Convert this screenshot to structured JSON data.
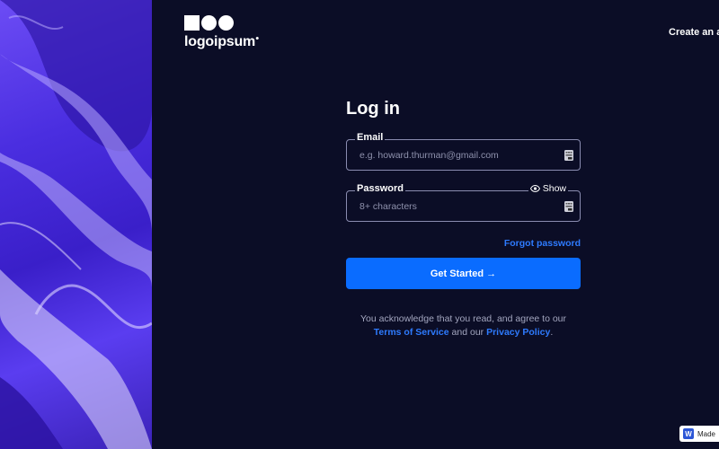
{
  "header": {
    "logo_text": "logoipsum",
    "top_link": "Create an ac"
  },
  "form": {
    "title": "Log in",
    "email": {
      "label": "Email",
      "placeholder": "e.g. howard.thurman@gmail.com",
      "value": ""
    },
    "password": {
      "label": "Password",
      "placeholder": "8+ characters",
      "value": "",
      "show_label": "Show"
    },
    "forgot_label": "Forgot password",
    "submit_label": "Get Started →"
  },
  "legal": {
    "line1": "You acknowledge that you read, and agree to our",
    "terms_label": "Terms of Service",
    "and_text": "and our",
    "privacy_label": "Privacy Policy",
    "end_text": "."
  },
  "badge": {
    "icon_letter": "W",
    "label": "Made"
  },
  "colors": {
    "background": "#0b0d26",
    "accent": "#0a6cff",
    "link": "#2e7bff"
  },
  "icons": {
    "keyboard": "keyboard-icon",
    "eye": "eye-icon"
  }
}
